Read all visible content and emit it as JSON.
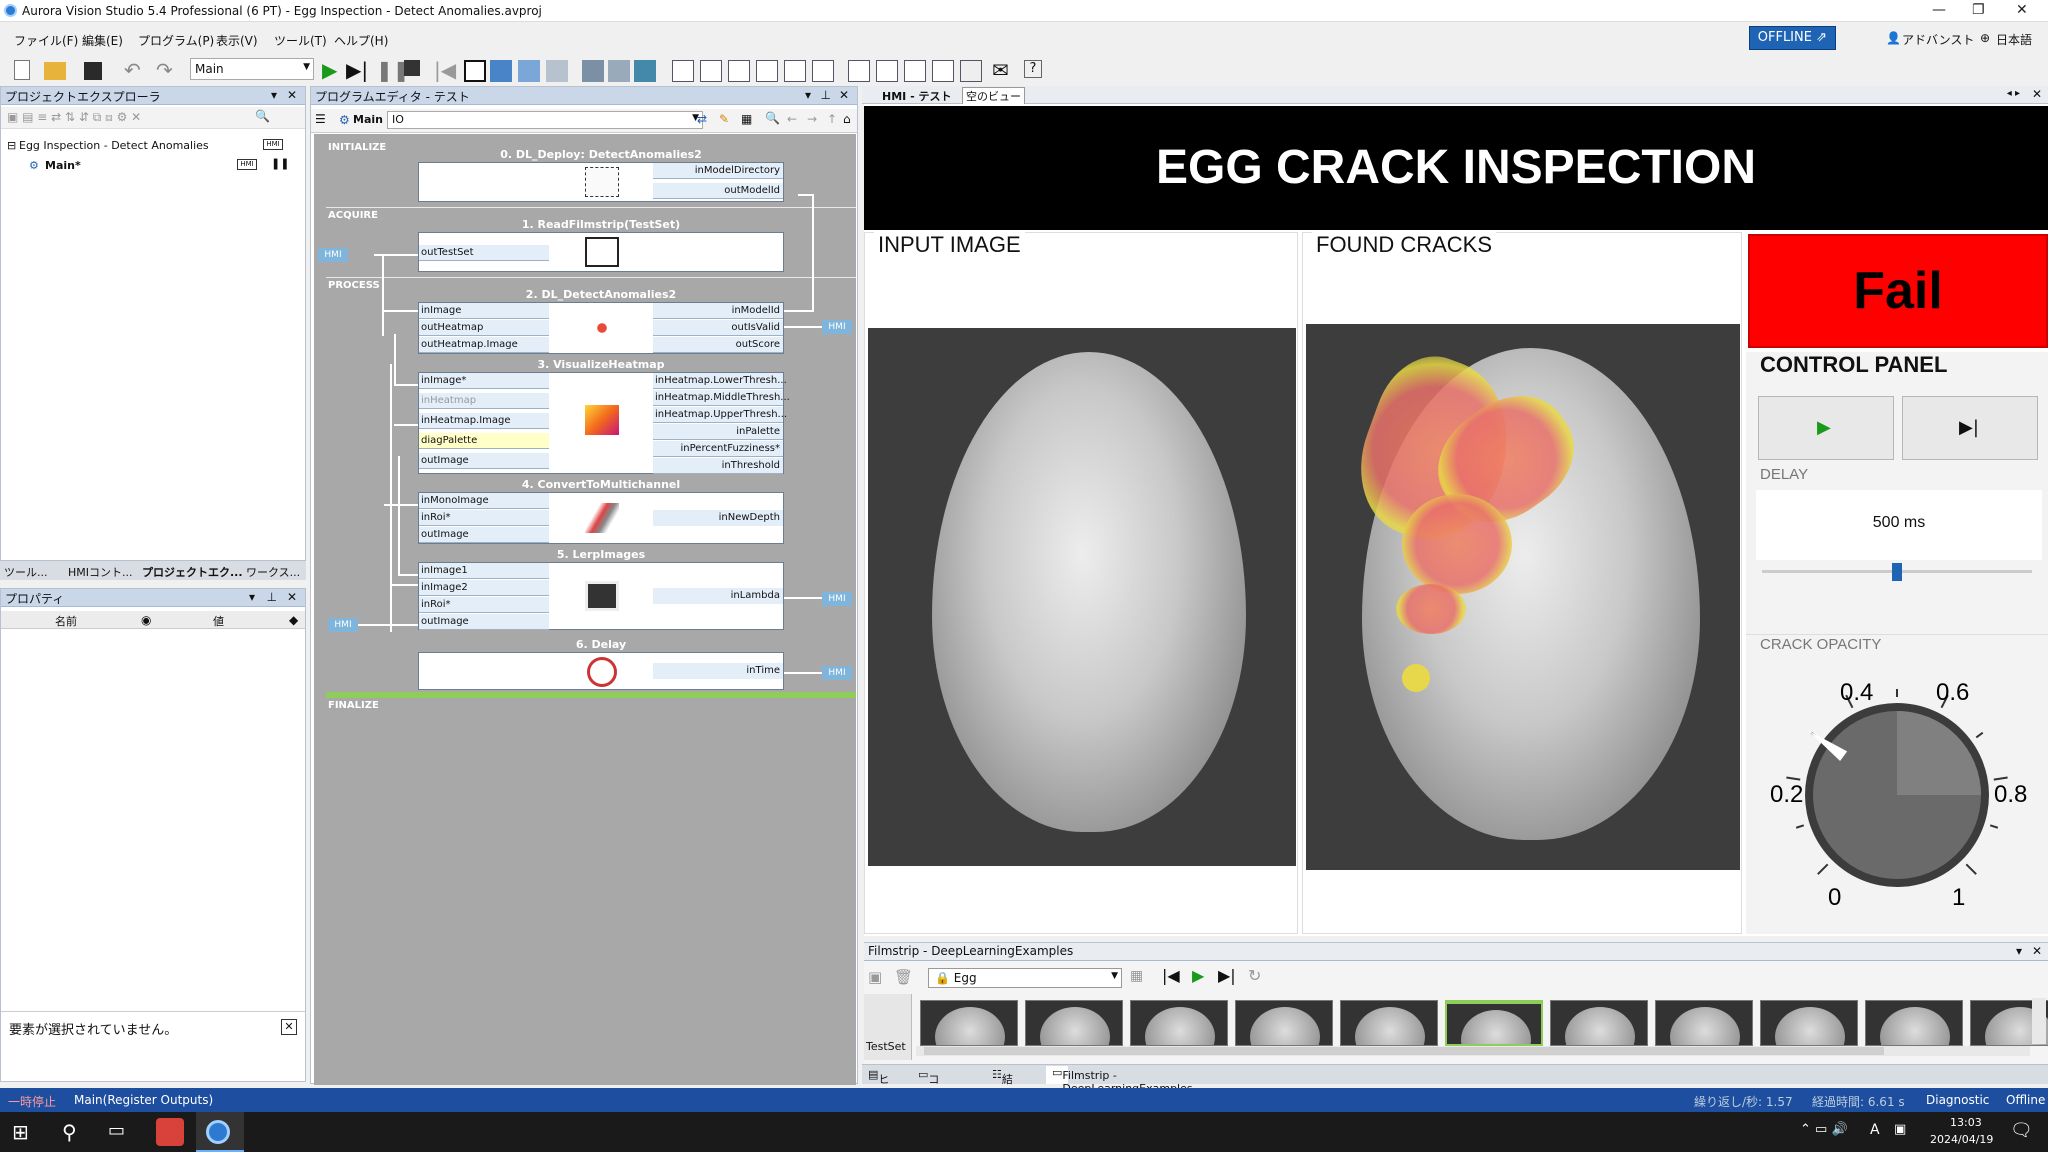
{
  "window": {
    "title": "Aurora Vision Studio 5.4 Professional (6 PT) - Egg  Inspection - Detect Anomalies.avproj"
  },
  "menu": [
    "ファイル(F)",
    "編集(E)",
    "プログラム(P)",
    "表示(V)",
    "ツール(T)",
    "ヘルプ(H)"
  ],
  "topright": {
    "offline": "OFFLINE",
    "advanced": "アドバンスト",
    "language": "日本語"
  },
  "toolbar": {
    "program_select": "Main"
  },
  "explorer": {
    "title": "プロジェクトエクスプローラ",
    "project": "Egg  Inspection - Detect Anomalies",
    "main": "Main*",
    "hmi_badge": "HMI"
  },
  "left_tabs": [
    "ツール...",
    "HMIコント...",
    "プロジェクトエク...",
    "ワークス..."
  ],
  "properties": {
    "title": "プロパティ",
    "col_name": "名前",
    "col_value": "値",
    "none_selected": "要素が選択されていません。"
  },
  "editor": {
    "title": "プログラムエディタ - テスト",
    "tab_main": "Main",
    "tab_io": "IO",
    "sections": [
      "INITIALIZE",
      "ACQUIRE",
      "PROCESS",
      "FINALIZE"
    ],
    "hmi_label": "HMI",
    "blocks": {
      "b0": {
        "title": "0. DL_Deploy: DetectAnomalies2",
        "outputs": [
          "inModelDirectory",
          "outModelId"
        ]
      },
      "b1": {
        "title": "1. ReadFilmstrip(TestSet)",
        "inputs": [
          "outTestSet"
        ]
      },
      "b2": {
        "title": "2. DL_DetectAnomalies2",
        "inputs": [
          "inImage",
          "outHeatmap",
          "outHeatmap.Image"
        ],
        "outputs": [
          "inModelId",
          "outIsValid",
          "outScore"
        ]
      },
      "b3": {
        "title": "3. VisualizeHeatmap",
        "inputs": [
          "inImage*",
          "inHeatmap",
          "inHeatmap.Image",
          "diagPalette",
          "outImage"
        ],
        "outputs": [
          "inHeatmap.LowerThresh...",
          "inHeatmap.MiddleThresh...",
          "inHeatmap.UpperThresh...",
          "inPalette",
          "inPercentFuzziness*",
          "inThreshold"
        ]
      },
      "b4": {
        "title": "4. ConvertToMultichannel",
        "inputs": [
          "inMonoImage",
          "inRoi*",
          "outImage"
        ],
        "outputs": [
          "inNewDepth"
        ]
      },
      "b5": {
        "title": "5. LerpImages",
        "inputs": [
          "inImage1",
          "inImage2",
          "inRoi*",
          "outImage"
        ],
        "outputs": [
          "inLambda"
        ]
      },
      "b6": {
        "title": "6. Delay",
        "outputs": [
          "inTime"
        ]
      }
    }
  },
  "hmi": {
    "tab": "HMI - テスト",
    "tab2": "空のビュー",
    "banner": "EGG CRACK INSPECTION",
    "input_caption": "INPUT IMAGE",
    "cracks_caption": "FOUND CRACKS",
    "result": "Fail",
    "control_panel": "CONTROL PANEL",
    "delay_label": "DELAY",
    "delay_value": "500 ms",
    "delay_slider_fraction": 0.5,
    "opacity_label": "CRACK OPACITY",
    "opacity_value": 0.3,
    "dial_ticks": [
      "0",
      "0.2",
      "0.4",
      "0.6",
      "0.8",
      "1"
    ]
  },
  "filmstrip": {
    "title": "Filmstrip - DeepLearningExamples",
    "dataset": "Egg",
    "row_label": "TestSet",
    "selected_index": 5,
    "thumb_count": 11
  },
  "bottom_tabs": [
    "ヒント",
    "コンソール",
    "結果",
    "Filmstrip - DeepLearningExamples"
  ],
  "status": {
    "state": "一時停止",
    "step": "Main(Register Outputs)",
    "fps": "繰り返し/秒: 1.57",
    "elapsed": "経過時間: 6.61 s",
    "diagnostic": "Diagnostic",
    "mode": "Offline"
  },
  "taskbar": {
    "time": "13:03",
    "date": "2024/04/19",
    "ime": "A"
  }
}
